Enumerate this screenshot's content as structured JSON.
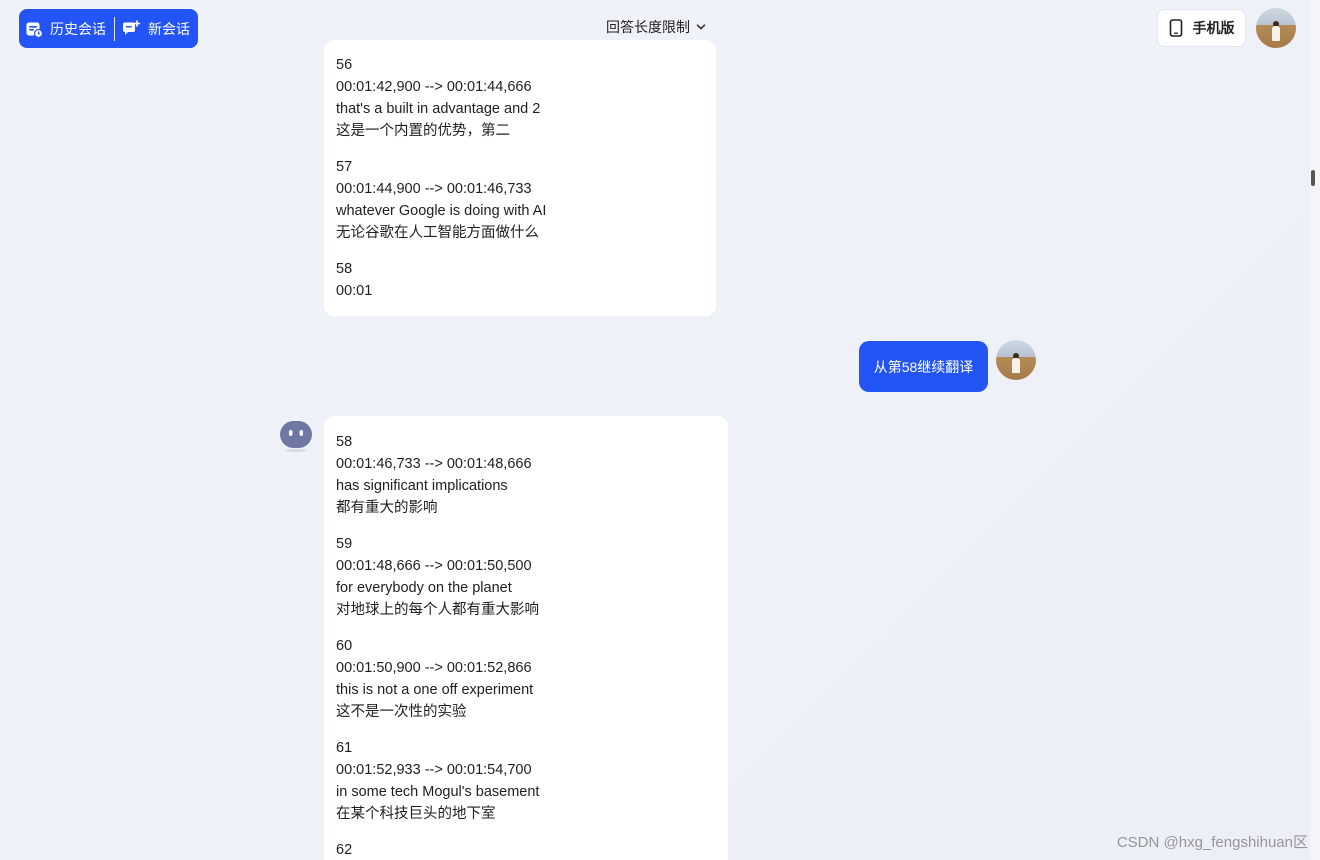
{
  "header": {
    "history_label": "历史会话",
    "new_chat_label": "新会话",
    "length_limit_label": "回答长度限制",
    "mobile_label": "手机版"
  },
  "colors": {
    "accent": "#2354f5",
    "background": "#eef1f9",
    "card": "#ffffff"
  },
  "icons": {
    "history": "history-calendar-icon",
    "new_chat": "new-chat-icon",
    "dropdown": "chevron-down-icon",
    "mobile": "phone-icon",
    "bot": "bot-avatar-icon"
  },
  "conversation": {
    "assistant_message_1": [
      {
        "index": "56",
        "time": "00:01:42,900 --> 00:01:44,666",
        "en": "that's a built in advantage and 2",
        "zh": "这是一个内置的优势，第二"
      },
      {
        "index": "57",
        "time": "00:01:44,900 --> 00:01:46,733",
        "en": "whatever Google is doing with AI",
        "zh": "无论谷歌在人工智能方面做什么"
      },
      {
        "index": "58",
        "time": "00:01",
        "en": "",
        "zh": ""
      }
    ],
    "user_message": "从第58继续翻译",
    "assistant_message_2": [
      {
        "index": "58",
        "time": "00:01:46,733 --> 00:01:48,666",
        "en": "has significant implications",
        "zh": "都有重大的影响"
      },
      {
        "index": "59",
        "time": "00:01:48,666 --> 00:01:50,500",
        "en": "for everybody on the planet",
        "zh": "对地球上的每个人都有重大影响"
      },
      {
        "index": "60",
        "time": "00:01:50,900 --> 00:01:52,866",
        "en": "this is not a one off experiment",
        "zh": "这不是一次性的实验"
      },
      {
        "index": "61",
        "time": "00:01:52,933 --> 00:01:54,700",
        "en": "in some tech Mogul's basement",
        "zh": "在某个科技巨头的地下室"
      },
      {
        "index": "62",
        "time": "",
        "en": "",
        "zh": ""
      }
    ]
  },
  "watermark": "CSDN @hxg_fengshihuan区"
}
